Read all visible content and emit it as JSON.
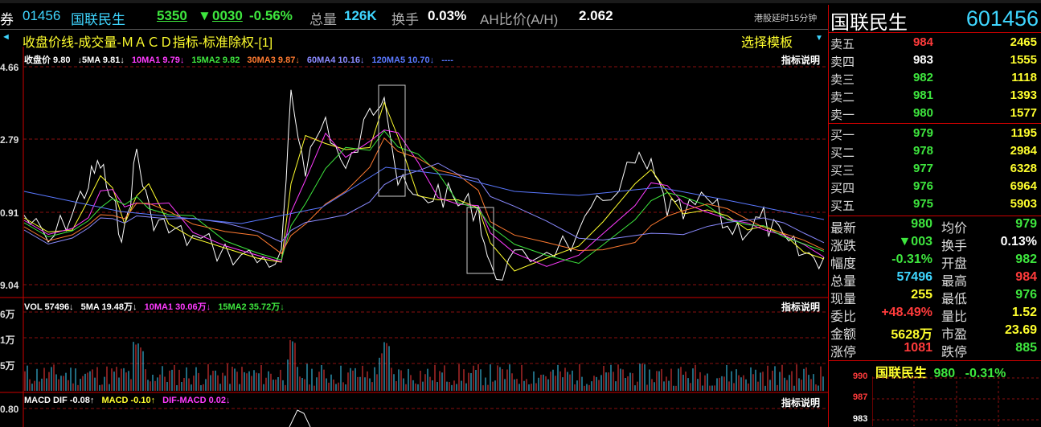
{
  "header": {
    "left_fragment": "券",
    "code": "01456",
    "name": "国联民生",
    "bid_ask": "5350",
    "change_arrow": "▼",
    "change_value": "0030",
    "change_pct": "-0.56%",
    "total_vol_label": "总量",
    "total_vol": "126K",
    "turnover_label": "换手",
    "turnover": "0.03%",
    "ah_label": "AH比价(A/H)",
    "ah_value": "2.062",
    "delay_note": "港股延时15分钟"
  },
  "chart_header": {
    "title": "收盘价线-成交量-ＭＡＣＤ指标-标准除权-[1]",
    "template_button": "选择模板",
    "left_marker": "◄"
  },
  "price_indicators": {
    "close": "收盘价 9.80",
    "ma5": "↓5MA 9.81↓",
    "ma10": "10MA1 9.79↓",
    "ma15": "15MA2 9.82",
    "ma30": "30MA3 9.87↓",
    "ma60": "60MA4 10.16↓",
    "ma120": "120MA5 10.70↓",
    "dash": "----",
    "explain": "指标说明"
  },
  "price_axis": {
    "t1": "4.66",
    "t2": "2.79",
    "t3": "0.91",
    "t4": "9.04"
  },
  "vol_indicators": {
    "vol": "VOL 57496↓",
    "ma5": "5MA 19.48万↓",
    "ma10": "10MA1 30.06万↓",
    "ma15": "15MA2 35.72万↓",
    "explain": "指标说明"
  },
  "vol_axis": {
    "t1": "6万",
    "t2": "1万",
    "t3": "5万"
  },
  "macd_indicators": {
    "dif": "MACD DIF -0.08↑",
    "macd": "MACD -0.10↑",
    "diff": "DIF-MACD 0.02↓",
    "explain": "指标说明"
  },
  "macd_axis": {
    "t1": "0.80"
  },
  "right_panel": {
    "name": "国联民生",
    "code": "601456",
    "asks": [
      {
        "label": "卖五",
        "price": "984",
        "vol": "2465",
        "color": "#ff3b3b"
      },
      {
        "label": "卖四",
        "price": "983",
        "vol": "1555",
        "color": "#ffffff"
      },
      {
        "label": "卖三",
        "price": "982",
        "vol": "1118",
        "color": "#3ee63e"
      },
      {
        "label": "卖二",
        "price": "981",
        "vol": "1393",
        "color": "#3ee63e"
      },
      {
        "label": "卖一",
        "price": "980",
        "vol": "1577",
        "color": "#3ee63e"
      }
    ],
    "bids": [
      {
        "label": "买一",
        "price": "979",
        "vol": "1195",
        "color": "#3ee63e"
      },
      {
        "label": "买二",
        "price": "978",
        "vol": "2984",
        "color": "#3ee63e"
      },
      {
        "label": "买三",
        "price": "977",
        "vol": "6328",
        "color": "#3ee63e"
      },
      {
        "label": "买四",
        "price": "976",
        "vol": "6964",
        "color": "#3ee63e"
      },
      {
        "label": "买五",
        "price": "975",
        "vol": "5903",
        "color": "#3ee63e"
      }
    ],
    "stats": [
      {
        "l1": "最新",
        "v1": "980",
        "c1": "#3ee63e",
        "l2": "均价",
        "v2": "979",
        "c2": "#3ee63e"
      },
      {
        "l1": "涨跌",
        "v1": "▼003",
        "c1": "#3ee63e",
        "l2": "换手",
        "v2": "0.13%",
        "c2": "#ffffff"
      },
      {
        "l1": "幅度",
        "v1": "-0.31%",
        "c1": "#3ee63e",
        "l2": "开盘",
        "v2": "982",
        "c2": "#3ee63e"
      },
      {
        "l1": "总量",
        "v1": "57496",
        "c1": "#3fd6ff",
        "l2": "最高",
        "v2": "984",
        "c2": "#ff3b3b"
      },
      {
        "l1": "现量",
        "v1": "255",
        "c1": "#ffff2e",
        "l2": "最低",
        "v2": "976",
        "c2": "#3ee63e"
      },
      {
        "l1": "委比",
        "v1": "+48.49%",
        "c1": "#ff3b3b",
        "l2": "量比",
        "v2": "1.52",
        "c2": "#ffff2e"
      },
      {
        "l1": "金额",
        "v1": "5628万",
        "c1": "#ffff2e",
        "l2": "市盈",
        "v2": "23.69",
        "c2": "#ffff2e"
      },
      {
        "l1": "涨停",
        "v1": "1081",
        "c1": "#ff3b3b",
        "l2": "跌停",
        "v2": "885",
        "c2": "#3ee63e"
      }
    ],
    "mini": {
      "name": "国联民生",
      "price": "980",
      "pct": "-0.31%",
      "axis": [
        "990",
        "987",
        "983"
      ]
    }
  }
}
